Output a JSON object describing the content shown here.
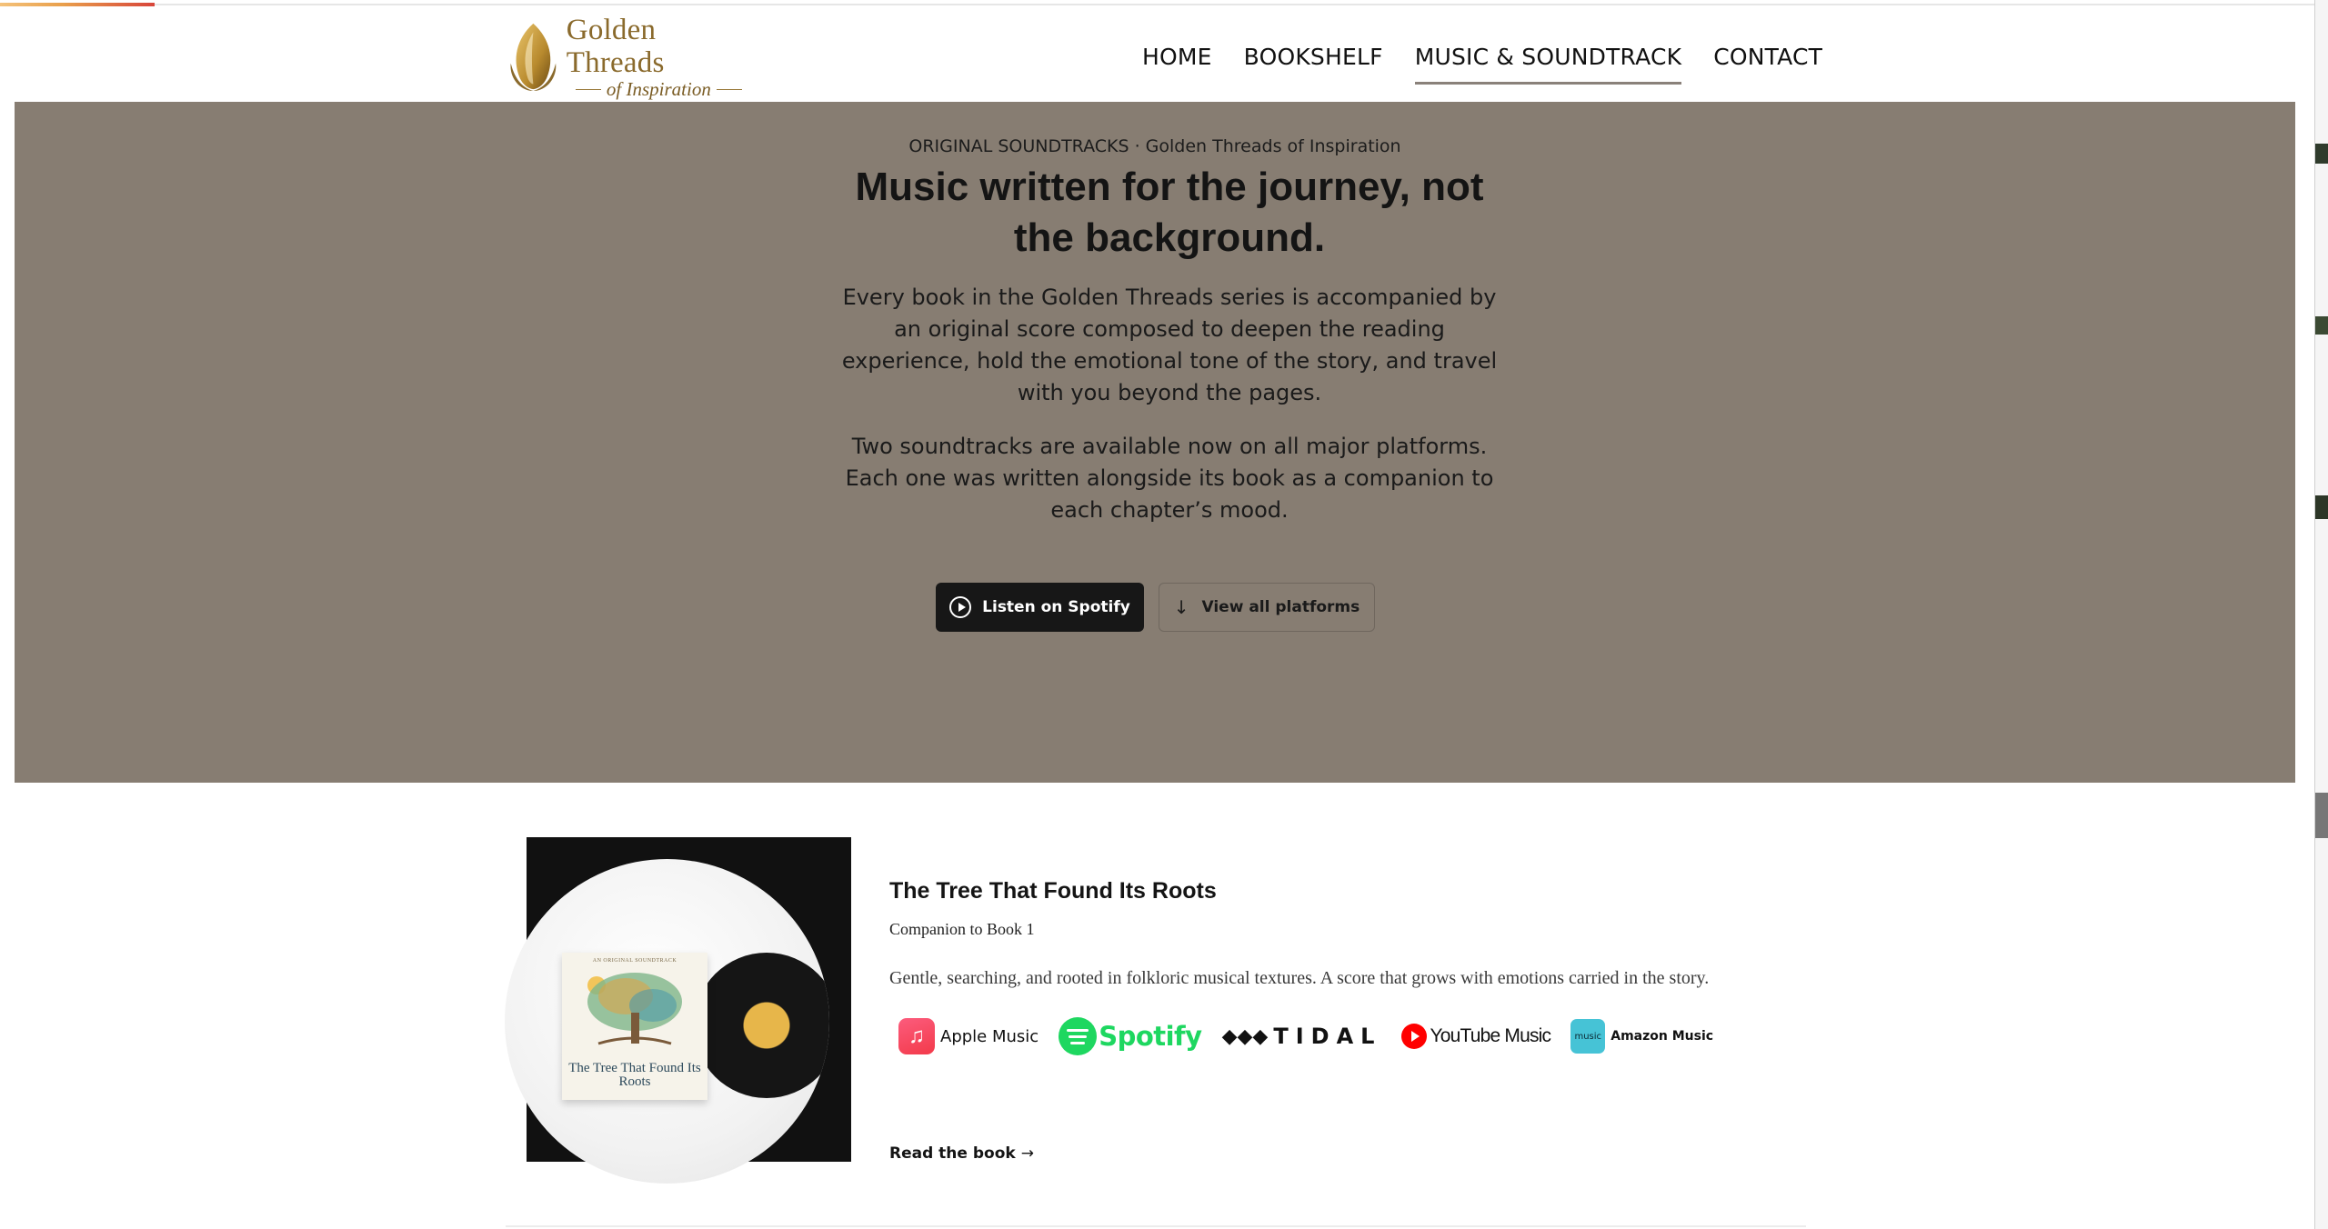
{
  "header": {
    "logo": {
      "title": "Golden Threads",
      "subtitle": "of Inspiration"
    },
    "nav": [
      {
        "label": "HOME",
        "active": false
      },
      {
        "label": "BOOKSHELF",
        "active": false
      },
      {
        "label": "MUSIC & SOUNDTRACK",
        "active": true
      },
      {
        "label": "CONTACT",
        "active": false
      }
    ]
  },
  "hero": {
    "eyebrow": "ORIGINAL SOUNDTRACKS · Golden Threads of Inspiration",
    "title": "Music written for the journey, not the background.",
    "paragraph1": "Every book in the Golden Threads series is accompanied by an original score composed to deepen the reading experience, hold the emotional tone of the story, and travel with you beyond the pages.",
    "paragraph2": "Two soundtracks are available now on all major platforms. Each one was written alongside its book as a companion to each chapter’s mood.",
    "primary_button": "Listen on Spotify",
    "secondary_button": "View all platforms",
    "background_color": "#877d72"
  },
  "album": {
    "title": "The Tree That Found Its Roots",
    "subtitle": "Companion to Book 1",
    "description": "Gentle, searching, and rooted in folkloric musical textures. A score that grows with emotions carried in the story.",
    "cover": {
      "top_text": "AN ORIGINAL SOUNDTRACK",
      "title": "The Tree That Found Its Roots"
    },
    "platforms": [
      {
        "name": "Apple Music",
        "icon": "apple-music-icon"
      },
      {
        "name": "Spotify",
        "icon": "spotify-icon"
      },
      {
        "name": "TIDAL",
        "icon": "tidal-icon"
      },
      {
        "name": "YouTube Music",
        "icon": "youtube-music-icon"
      },
      {
        "name": "Amazon Music",
        "icon": "amazon-music-icon",
        "icon_text": "music"
      }
    ],
    "read_link": "Read the book"
  },
  "colors": {
    "accent_dark": "#171717",
    "gold": "#8a6a2c",
    "spotify": "#1ed760"
  }
}
